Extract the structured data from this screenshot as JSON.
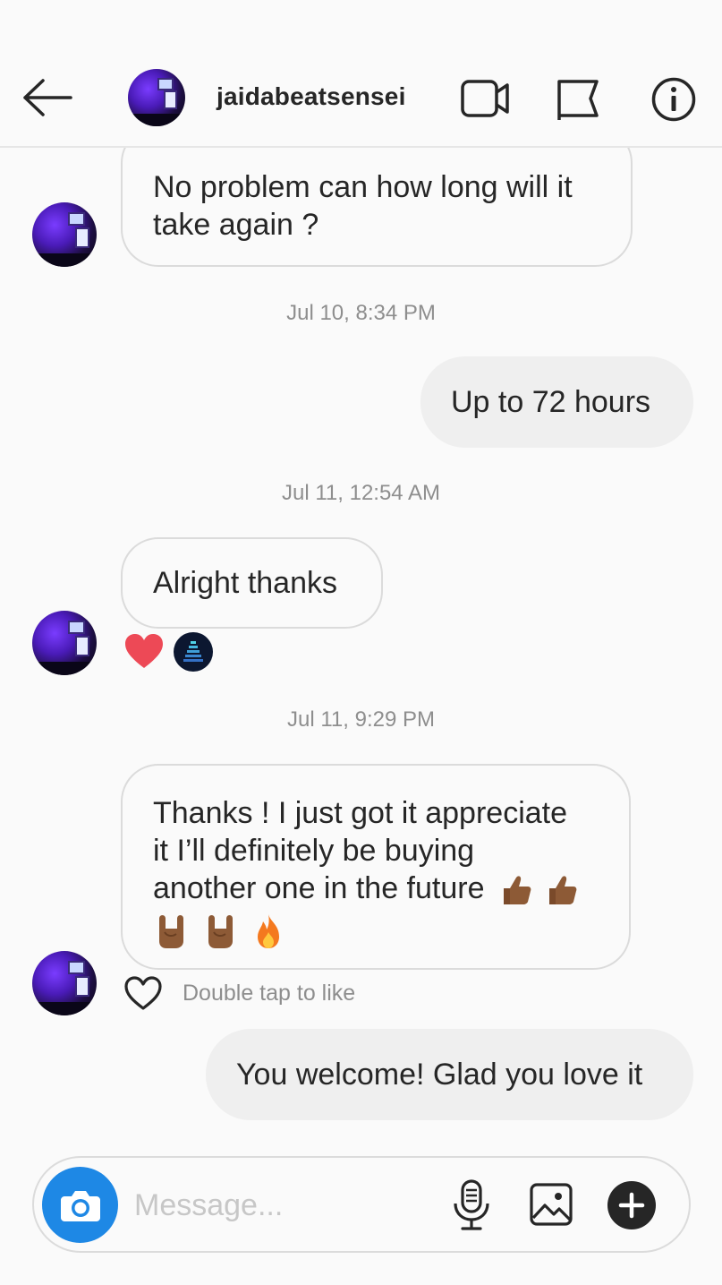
{
  "header": {
    "username": "jaidabeatsensei",
    "icons": [
      "back-arrow-icon",
      "video-call-icon",
      "flag-icon",
      "info-icon"
    ]
  },
  "messages": [
    {
      "from": "them",
      "text": "No problem can how long will it take again ?"
    },
    {
      "timestamp": "Jul 10, 8:34 PM"
    },
    {
      "from": "me",
      "text": "Up to 72 hours"
    },
    {
      "timestamp": "Jul 11, 12:54 AM"
    },
    {
      "from": "them",
      "text": "Alright thanks",
      "reactions": [
        "heart",
        "avatar"
      ]
    },
    {
      "timestamp": "Jul 11, 9:29 PM"
    },
    {
      "from": "them",
      "text_lines": [
        "Thanks ! I just got it appreciate",
        "it I’ll definitely be buying",
        "another one in the future"
      ],
      "emojis": [
        "thumbs-up",
        "thumbs-up",
        "rock-on",
        "rock-on",
        "fire"
      ],
      "hint": "Double tap to like"
    },
    {
      "from": "me",
      "text": "You welcome! Glad you love it"
    }
  ],
  "m1": {
    "line1": "No problem can how long will it",
    "line2": "take again ?"
  },
  "ts1": "Jul 10, 8:34 PM",
  "m2": "Up to 72 hours",
  "ts2": "Jul 11, 12:54 AM",
  "m3": "Alright thanks",
  "ts3": "Jul 11, 9:29 PM",
  "m4": {
    "line1": "Thanks ! I just got it appreciate",
    "line2": "it I’ll definitely be buying",
    "line3": "another one in the future"
  },
  "hint": "Double tap to like",
  "m5": "You welcome! Glad you love it",
  "composer": {
    "placeholder": "Message..."
  },
  "colors": {
    "accent": "#1e88e5",
    "heart": "#ed4956",
    "bubble_out": "#efefef",
    "border": "#dbdbdb"
  }
}
